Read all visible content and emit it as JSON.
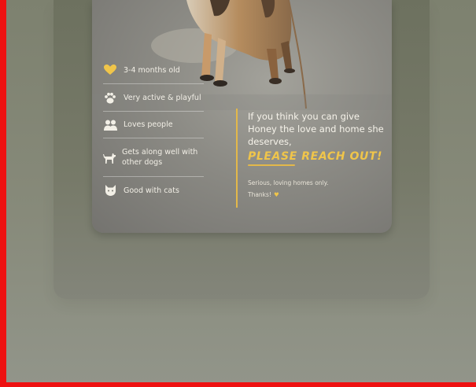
{
  "poster": {
    "facts": [
      {
        "icon": "heart-icon",
        "text": "3-4 months old"
      },
      {
        "icon": "paw-icon",
        "text": "Very active & playful"
      },
      {
        "icon": "people-icon",
        "text": "Loves people"
      },
      {
        "icon": "dog-icon",
        "text": "Gets along well with other dogs"
      },
      {
        "icon": "cat-icon",
        "text": "Good with cats"
      }
    ],
    "cta_text": "If you think you can give Honey the love and home she deserves,",
    "cta_reach": "PLEASE REACH OUT!",
    "cta_small_1": "Serious, loving homes only.",
    "cta_small_2": "Thanks!"
  },
  "colors": {
    "accent": "#e3b84a",
    "frame": "#ee1111"
  }
}
